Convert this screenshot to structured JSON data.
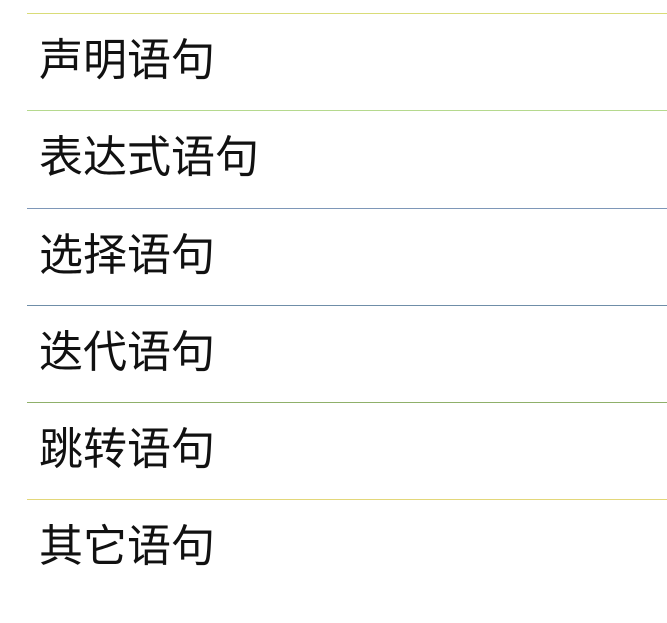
{
  "items": [
    {
      "label": "声明语句",
      "line_color": "#d9dc78"
    },
    {
      "label": "表达式语句",
      "line_color": "#b5d98e"
    },
    {
      "label": "选择语句",
      "line_color": "#7e97b8"
    },
    {
      "label": "迭代语句",
      "line_color": "#6f8ea8"
    },
    {
      "label": "跳转语句",
      "line_color": "#8fb06a"
    },
    {
      "label": "其它语句",
      "line_color": "#e3d77a"
    }
  ]
}
